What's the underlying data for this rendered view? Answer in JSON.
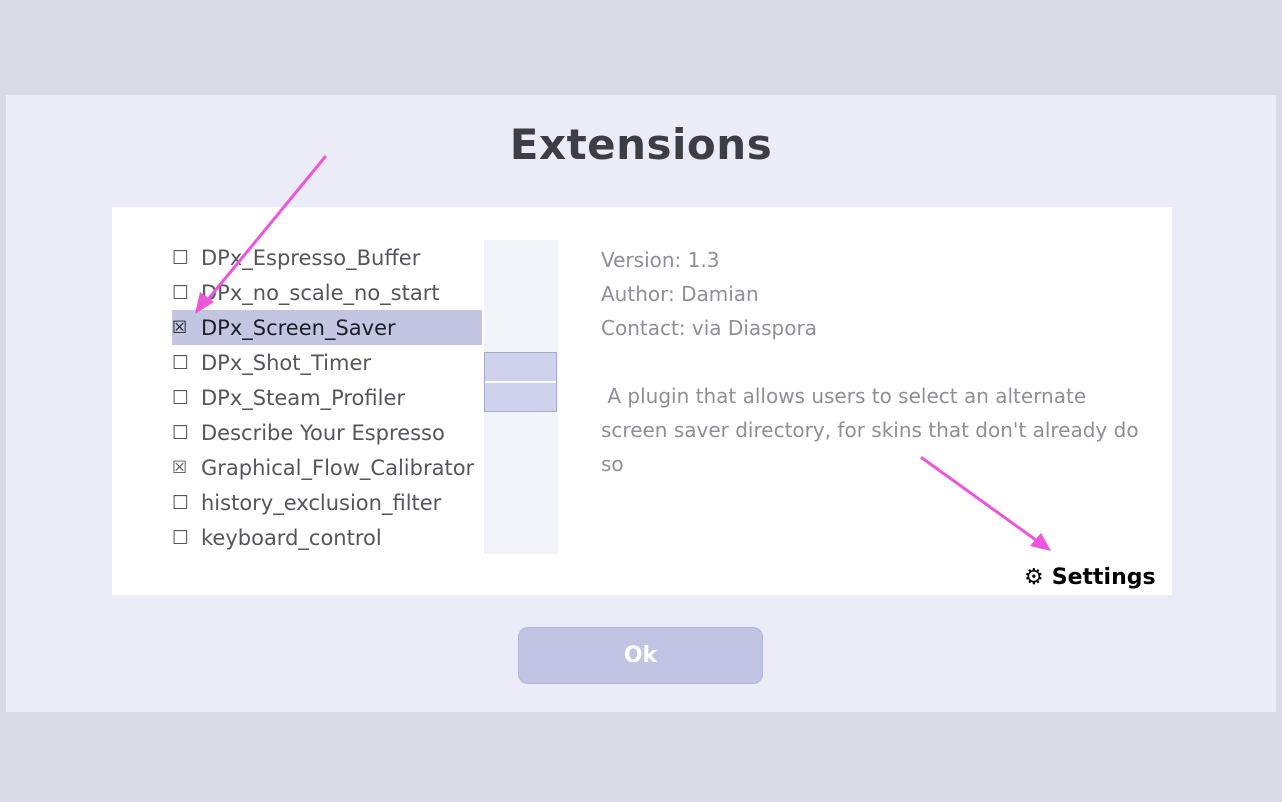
{
  "dialog": {
    "title": "Extensions",
    "ok_label": "Ok"
  },
  "extensions": {
    "items": [
      {
        "checkbox": "☐",
        "name": "DPx_Espresso_Buffer",
        "checked": false,
        "selected": false
      },
      {
        "checkbox": "☐",
        "name": "DPx_no_scale_no_start",
        "checked": false,
        "selected": false
      },
      {
        "checkbox": "☒",
        "name": "DPx_Screen_Saver",
        "checked": true,
        "selected": true
      },
      {
        "checkbox": "☐",
        "name": "DPx_Shot_Timer",
        "checked": false,
        "selected": false
      },
      {
        "checkbox": "☐",
        "name": "DPx_Steam_Profiler",
        "checked": false,
        "selected": false
      },
      {
        "checkbox": "☐",
        "name": "Describe Your Espresso",
        "checked": false,
        "selected": false
      },
      {
        "checkbox": "☒",
        "name": "Graphical_Flow_Calibrator",
        "checked": true,
        "selected": false
      },
      {
        "checkbox": "☐",
        "name": "history_exclusion_filter",
        "checked": false,
        "selected": false
      },
      {
        "checkbox": "☐",
        "name": "keyboard_control",
        "checked": false,
        "selected": false
      }
    ]
  },
  "details": {
    "version": "Version: 1.3",
    "author": "Author: Damian",
    "contact": "Contact: via Diaspora",
    "description": " A plugin that allows users to select an alternate screen saver directory, for skins that don't already do so",
    "settings_icon": "⚙",
    "settings_label": "Settings"
  },
  "colors": {
    "dialog_bg": "#ecebf8",
    "selected_row": "#c3c5e2",
    "ok_button": "#c1c4e2",
    "annotation_arrow": "#ee55dd"
  },
  "icons": {
    "settings": "gear-icon",
    "annotation": "arrow-icon"
  }
}
